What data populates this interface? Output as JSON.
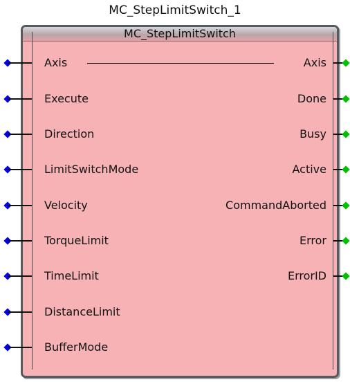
{
  "instance_name": "MC_StepLimitSwitch_1",
  "block_type": "MC_StepLimitSwitch",
  "colors": {
    "block_fill": "#f7b2b6",
    "input_pin": "#0000ee",
    "output_pin": "#00c000"
  },
  "inputs": [
    {
      "label": "Axis"
    },
    {
      "label": "Execute"
    },
    {
      "label": "Direction"
    },
    {
      "label": "LimitSwitchMode"
    },
    {
      "label": "Velocity"
    },
    {
      "label": "TorqueLimit"
    },
    {
      "label": "TimeLimit"
    },
    {
      "label": "DistanceLimit"
    },
    {
      "label": "BufferMode"
    }
  ],
  "outputs": [
    {
      "label": "Axis"
    },
    {
      "label": "Done"
    },
    {
      "label": "Busy"
    },
    {
      "label": "Active"
    },
    {
      "label": "CommandAborted"
    },
    {
      "label": "Error"
    },
    {
      "label": "ErrorID"
    }
  ]
}
